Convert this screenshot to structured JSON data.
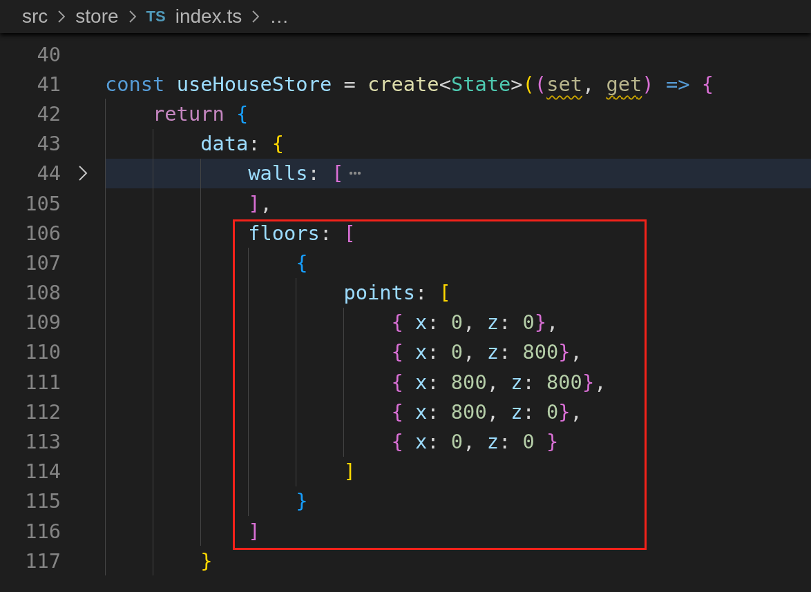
{
  "breadcrumb": {
    "items": [
      {
        "label": "src"
      },
      {
        "label": "store"
      },
      {
        "label": "index.ts",
        "badge": "TS"
      },
      {
        "label": "…"
      }
    ]
  },
  "lines": [
    {
      "number": "40"
    },
    {
      "number": "41",
      "tokens": [
        {
          "text": "const ",
          "kind": "keyword"
        },
        {
          "text": "useHouseStore",
          "kind": "variable"
        },
        {
          "text": " = ",
          "kind": "punct"
        },
        {
          "text": "create",
          "kind": "function"
        },
        {
          "text": "<",
          "kind": "punct"
        },
        {
          "text": "State",
          "kind": "type"
        },
        {
          "text": ">",
          "kind": "punct"
        },
        {
          "text": "(",
          "kind": "bracket-gold"
        },
        {
          "text": "(",
          "kind": "bracket-orchid"
        },
        {
          "text": "set",
          "kind": "param",
          "warning": true
        },
        {
          "text": ", ",
          "kind": "punct"
        },
        {
          "text": "get",
          "kind": "param",
          "warning": true
        },
        {
          "text": ")",
          "kind": "bracket-orchid"
        },
        {
          "text": " => ",
          "kind": "operator"
        },
        {
          "text": "{",
          "kind": "bracket-orchid"
        }
      ]
    },
    {
      "number": "42",
      "tokens": [
        {
          "text": "    return ",
          "kind": "control"
        },
        {
          "text": "{",
          "kind": "bracket-blue"
        }
      ]
    },
    {
      "number": "43",
      "tokens": [
        {
          "text": "        data",
          "kind": "property"
        },
        {
          "text": ": ",
          "kind": "punct"
        },
        {
          "text": "{",
          "kind": "bracket-gold"
        }
      ]
    },
    {
      "number": "44",
      "highlighted": true,
      "folded": true,
      "tokens": [
        {
          "text": "            walls",
          "kind": "property"
        },
        {
          "text": ": ",
          "kind": "punct"
        },
        {
          "text": "[",
          "kind": "bracket-orchid"
        }
      ]
    },
    {
      "number": "105",
      "tokens": [
        {
          "text": "            ]",
          "kind": "bracket-orchid"
        },
        {
          "text": ",",
          "kind": "punct"
        }
      ]
    },
    {
      "kind": "annotation-box",
      "lines": [
        {
          "number": "106",
          "tokens": [
            {
              "text": "            floors",
              "kind": "property"
            },
            {
              "text": ": ",
              "kind": "punct"
            },
            {
              "text": "[",
              "kind": "bracket-orchid"
            }
          ]
        },
        {
          "number": "107",
          "tokens": [
            {
              "text": "                {",
              "kind": "bracket-blue"
            }
          ]
        },
        {
          "number": "108",
          "tokens": [
            {
              "text": "                    points",
              "kind": "property"
            },
            {
              "text": ": ",
              "kind": "punct"
            },
            {
              "text": "[",
              "kind": "bracket-gold"
            }
          ]
        },
        {
          "number": "109",
          "tokens": [
            {
              "text": "                        { ",
              "kind": "bracket-orchid"
            },
            {
              "text": "x",
              "kind": "property"
            },
            {
              "text": ": ",
              "kind": "punct"
            },
            {
              "text": "0",
              "kind": "number"
            },
            {
              "text": ", ",
              "kind": "punct"
            },
            {
              "text": "z",
              "kind": "property"
            },
            {
              "text": ": ",
              "kind": "punct"
            },
            {
              "text": "0",
              "kind": "number"
            },
            {
              "text": "}",
              "kind": "bracket-orchid"
            },
            {
              "text": ",",
              "kind": "punct"
            }
          ]
        },
        {
          "number": "110",
          "tokens": [
            {
              "text": "                        { ",
              "kind": "bracket-orchid"
            },
            {
              "text": "x",
              "kind": "property"
            },
            {
              "text": ": ",
              "kind": "punct"
            },
            {
              "text": "0",
              "kind": "number"
            },
            {
              "text": ", ",
              "kind": "punct"
            },
            {
              "text": "z",
              "kind": "property"
            },
            {
              "text": ": ",
              "kind": "punct"
            },
            {
              "text": "800",
              "kind": "number"
            },
            {
              "text": "}",
              "kind": "bracket-orchid"
            },
            {
              "text": ",",
              "kind": "punct"
            }
          ]
        },
        {
          "number": "111",
          "tokens": [
            {
              "text": "                        { ",
              "kind": "bracket-orchid"
            },
            {
              "text": "x",
              "kind": "property"
            },
            {
              "text": ": ",
              "kind": "punct"
            },
            {
              "text": "800",
              "kind": "number"
            },
            {
              "text": ", ",
              "kind": "punct"
            },
            {
              "text": "z",
              "kind": "property"
            },
            {
              "text": ": ",
              "kind": "punct"
            },
            {
              "text": "800",
              "kind": "number"
            },
            {
              "text": "}",
              "kind": "bracket-orchid"
            },
            {
              "text": ",",
              "kind": "punct"
            }
          ]
        },
        {
          "number": "112",
          "tokens": [
            {
              "text": "                        { ",
              "kind": "bracket-orchid"
            },
            {
              "text": "x",
              "kind": "property"
            },
            {
              "text": ": ",
              "kind": "punct"
            },
            {
              "text": "800",
              "kind": "number"
            },
            {
              "text": ", ",
              "kind": "punct"
            },
            {
              "text": "z",
              "kind": "property"
            },
            {
              "text": ": ",
              "kind": "punct"
            },
            {
              "text": "0",
              "kind": "number"
            },
            {
              "text": "}",
              "kind": "bracket-orchid"
            },
            {
              "text": ",",
              "kind": "punct"
            }
          ]
        },
        {
          "number": "113",
          "tokens": [
            {
              "text": "                        { ",
              "kind": "bracket-orchid"
            },
            {
              "text": "x",
              "kind": "property"
            },
            {
              "text": ": ",
              "kind": "punct"
            },
            {
              "text": "0",
              "kind": "number"
            },
            {
              "text": ", ",
              "kind": "punct"
            },
            {
              "text": "z",
              "kind": "property"
            },
            {
              "text": ": ",
              "kind": "punct"
            },
            {
              "text": "0",
              "kind": "number"
            },
            {
              "text": " }",
              "kind": "bracket-orchid"
            }
          ]
        },
        {
          "number": "114",
          "tokens": [
            {
              "text": "                    ]",
              "kind": "bracket-gold"
            }
          ]
        },
        {
          "number": "115",
          "tokens": [
            {
              "text": "                }",
              "kind": "bracket-blue"
            }
          ]
        },
        {
          "number": "116",
          "tokens": [
            {
              "text": "            ]",
              "kind": "bracket-orchid"
            }
          ]
        }
      ]
    },
    {
      "number": "117",
      "tokens": [
        {
          "text": "        }",
          "kind": "bracket-gold"
        }
      ]
    }
  ]
}
